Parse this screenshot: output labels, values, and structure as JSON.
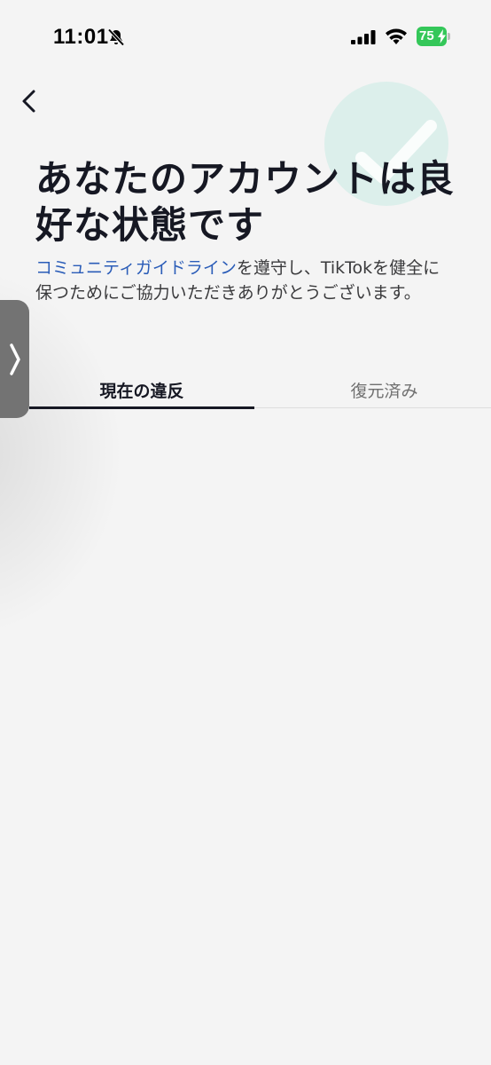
{
  "status_bar": {
    "time": "11:01",
    "battery_level": "75",
    "icons": [
      "bell-slash-icon",
      "cellular-signal-icon",
      "wifi-icon",
      "battery-charging-icon"
    ],
    "battery_color": "#34c759"
  },
  "header": {
    "back_icon": "chevron-left-icon",
    "badge_icon": "check-badge-icon",
    "title": "あなたのアカウントは良好な状態です"
  },
  "description": {
    "link_text": "コミュニティガイドライン",
    "rest_text": "を遵守し、TikTokを健全に保つためにご協力いただきありがとうございます。",
    "link_color": "#2b5db8"
  },
  "side_handle": {
    "icon": "chevron-right-icon"
  },
  "tabs": [
    {
      "label": "現在の違反",
      "selected": true
    },
    {
      "label": "復元済み",
      "selected": false
    }
  ]
}
